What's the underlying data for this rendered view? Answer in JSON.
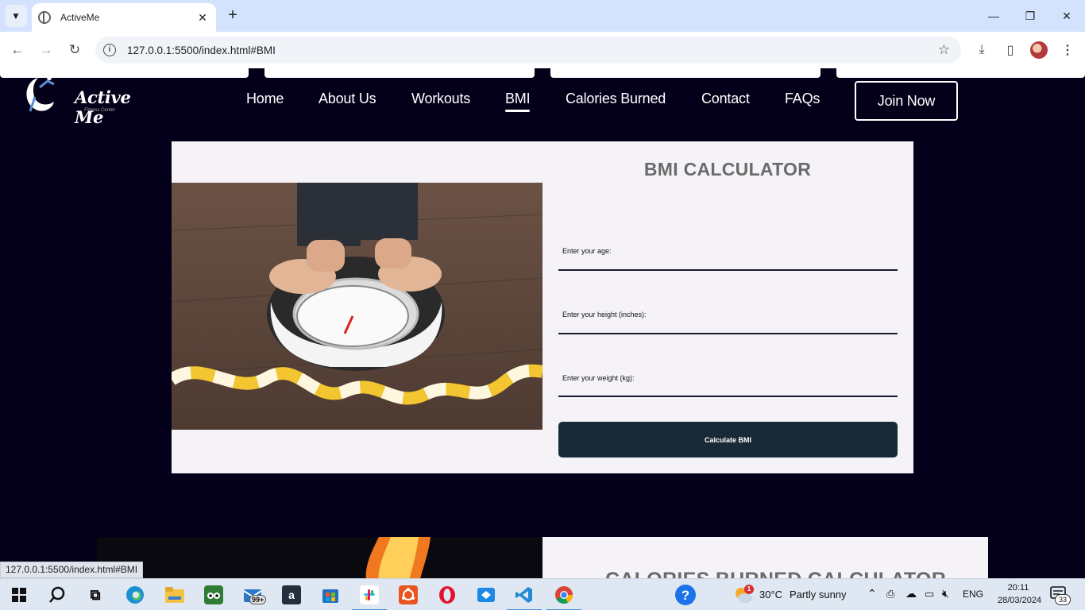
{
  "browser": {
    "tab_title": "ActiveMe",
    "tab_close": "✕",
    "new_tab": "+",
    "url": "127.0.0.1:5500/index.html#BMI",
    "status_url": "127.0.0.1:5500/index.html#BMI"
  },
  "site": {
    "logo_text": "Active Me",
    "logo_sub": "Fitness Center",
    "nav": [
      "Home",
      "About Us",
      "Workouts",
      "BMI",
      "Calories Burned",
      "Contact",
      "FAQs"
    ],
    "active_nav": "BMI",
    "join_label": "Join Now"
  },
  "bmi": {
    "title": "BMI CALCULATOR",
    "age_label": "Enter your age:",
    "height_label": "Enter your height (inches):",
    "weight_label": "Enter your weight (kg):",
    "button_label": "Calculate BMI"
  },
  "calories": {
    "title": "CALORIES BURNED CALCULATOR"
  },
  "taskbar": {
    "weather_temp": "30°C",
    "weather_desc": "Partly sunny",
    "lang": "ENG",
    "time": "20:11",
    "date": "28/03/2024",
    "notifications": "33",
    "mail_badge": "99+",
    "weather_badge": "1"
  }
}
